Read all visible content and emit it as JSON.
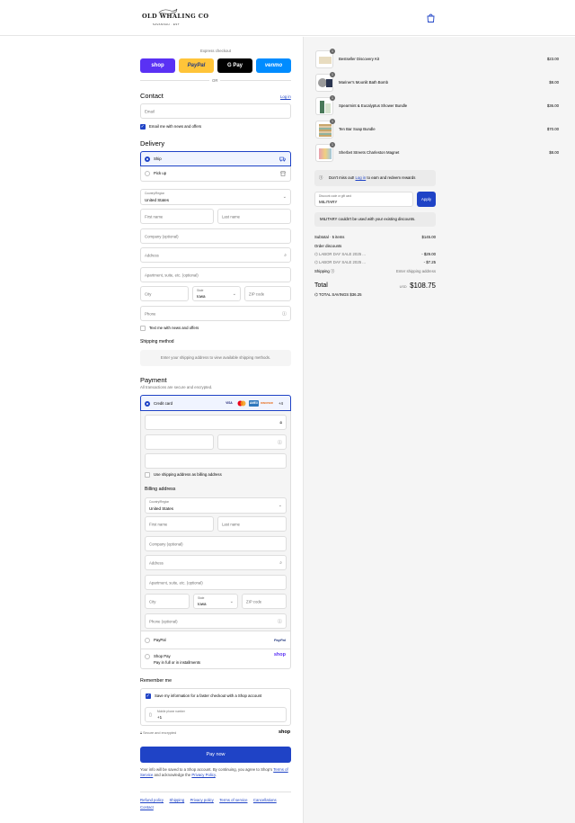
{
  "header": {
    "logo_text": "OLD WHALING CO",
    "logo_sub": "SAVANNAH · EST"
  },
  "express": {
    "title": "Express checkout",
    "buttons": [
      "shop",
      "PayPal",
      "G Pay",
      "venmo"
    ],
    "or": "OR"
  },
  "contact": {
    "title": "Contact",
    "login": "Log in",
    "email_placeholder": "Email",
    "email_news": "Email me with news and offers"
  },
  "delivery": {
    "title": "Delivery",
    "ship": "Ship",
    "pickup": "Pick up",
    "country_label": "Country/Region",
    "country_value": "United States",
    "first_name": "First name",
    "last_name": "Last name",
    "company": "Company (optional)",
    "address": "Address",
    "apartment": "Apartment, suite, etc. (optional)",
    "city": "City",
    "state_label": "State",
    "state_value": "Iowa",
    "zip": "ZIP code",
    "phone": "Phone",
    "text_news": "Text me with news and offers"
  },
  "shipping_method": {
    "title": "Shipping method",
    "message": "Enter your shipping address to view available shipping methods."
  },
  "payment": {
    "title": "Payment",
    "subtitle": "All transactions are secure and encrypted.",
    "credit_card": "Credit card",
    "brands": [
      "VISA",
      "MC",
      "AMEX",
      "DISCOVER"
    ],
    "more": "+4",
    "use_shipping": "Use shipping address as billing address",
    "billing_title": "Billing address",
    "paypal": "PayPal",
    "paypal_logo": "PayPal",
    "shop_pay": "Shop Pay",
    "shop_pay_sub": "Pay in full or in installments",
    "shop_logo": "shop"
  },
  "billing": {
    "country_label": "Country/Region",
    "country_value": "United States",
    "first_name": "First name",
    "last_name": "Last name",
    "company": "Company (optional)",
    "address": "Address",
    "apartment": "Apartment, suite, etc. (optional)",
    "city": "City",
    "state_label": "State",
    "state_value": "Iowa",
    "zip": "ZIP code",
    "phone": "Phone (optional)"
  },
  "remember": {
    "title": "Remember me",
    "save_info": "Save my information for a faster checkout with a Shop account",
    "mobile_label": "Mobile phone number",
    "mobile_value": "+1",
    "secure": "Secure and encrypted",
    "shop_logo": "shop"
  },
  "pay_now": "Pay now",
  "legal": {
    "line1": "Your info will be saved to a Shop account. By continuing, you agree to Shop's",
    "tos": "Terms of Service",
    "and": "and acknowledge the",
    "privacy": "Privacy Policy",
    "end": "."
  },
  "footer_links": [
    "Refund policy",
    "Shipping",
    "Privacy policy",
    "Terms of service",
    "Cancellations",
    "Contact"
  ],
  "cart": {
    "items": [
      {
        "name": "Bestseller Discovery Kit",
        "price": "$23.00",
        "qty": "1"
      },
      {
        "name": "Mariner's Moonlit Bath Bomb",
        "price": "$8.00",
        "qty": "1"
      },
      {
        "name": "Spearmint & Eucalyptus Shower Bundle",
        "price": "$36.00",
        "qty": "1"
      },
      {
        "name": "Ten Bar Soap Bundle",
        "price": "$70.00",
        "qty": "1"
      },
      {
        "name": "Sherbet Streets Charleston Magnet",
        "price": "$8.00",
        "qty": "1"
      }
    ],
    "rewards_pre": "Don't miss out!",
    "rewards_link": "Log in",
    "rewards_post": "to earn and redeem rewards",
    "discount_label": "Discount code or gift card",
    "discount_value": "MILITARY",
    "apply": "Apply",
    "discount_error": "MILITARY couldn't be used with your existing discounts.",
    "subtotal_label": "Subtotal · 5 items",
    "subtotal_value": "$145.00",
    "order_discounts": "Order discounts",
    "discounts": [
      {
        "label": "LABOR DAY SALE 2025 ...",
        "value": "- $29.00"
      },
      {
        "label": "LABOR DAY SALE 2025 ...",
        "value": "- $7.25"
      }
    ],
    "shipping_label": "Shipping",
    "shipping_value": "Enter shipping address",
    "total_label": "Total",
    "currency": "USD",
    "total_value": "$108.75",
    "savings_label": "TOTAL SAVINGS",
    "savings_value": "$36.25"
  },
  "colors": {
    "accent": "#1f43c6",
    "shop": "#5a31f4",
    "paypal": "#ffc439",
    "gpay": "#000000",
    "venmo": "#008cff"
  }
}
